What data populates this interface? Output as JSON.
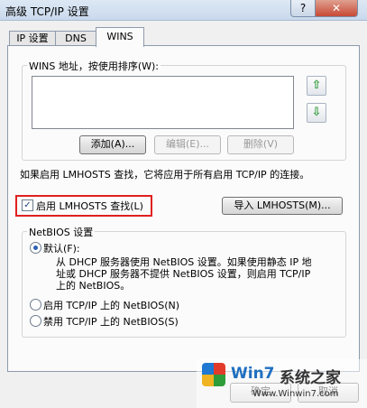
{
  "window": {
    "title": "高级 TCP/IP 设置",
    "help_label": "?",
    "close_label": "✕"
  },
  "tabs": [
    {
      "label": "IP 设置"
    },
    {
      "label": "DNS"
    },
    {
      "label": "WINS"
    }
  ],
  "wins": {
    "group_label": "WINS 地址，按使用排序(W):",
    "add_label": "添加(A)...",
    "edit_label": "编辑(E)...",
    "delete_label": "删除(V)"
  },
  "lmhosts": {
    "info_text": "如果启用 LMHOSTS 查找，它将应用于所有启用 TCP/IP 的连接。",
    "enable_label": "启用 LMHOSTS 查找(L)",
    "enable_checked": true,
    "import_label": "导入 LMHOSTS(M)..."
  },
  "netbios": {
    "group_label": "NetBIOS 设置",
    "default_label": "默认(F):",
    "default_desc_line1": "从 DHCP 服务器使用 NetBIOS 设置。如果使用静态 IP 地",
    "default_desc_line2": "址或 DHCP 服务器不提供 NetBIOS 设置，则启用 TCP/IP",
    "default_desc_line3": "上的 NetBIOS。",
    "enable_label": "启用 TCP/IP 上的 NetBIOS(N)",
    "disable_label": "禁用 TCP/IP 上的 NetBIOS(S)",
    "selected": "default"
  },
  "footer": {
    "ok_label": "确定",
    "cancel_label": "取消"
  },
  "watermark": {
    "logo_text": "Win7",
    "site_name": "系统之家",
    "url": "Www.Winwin7.com"
  },
  "colors": {
    "highlight_red": "#e02020",
    "arrow_green": "#2e9b3a"
  }
}
